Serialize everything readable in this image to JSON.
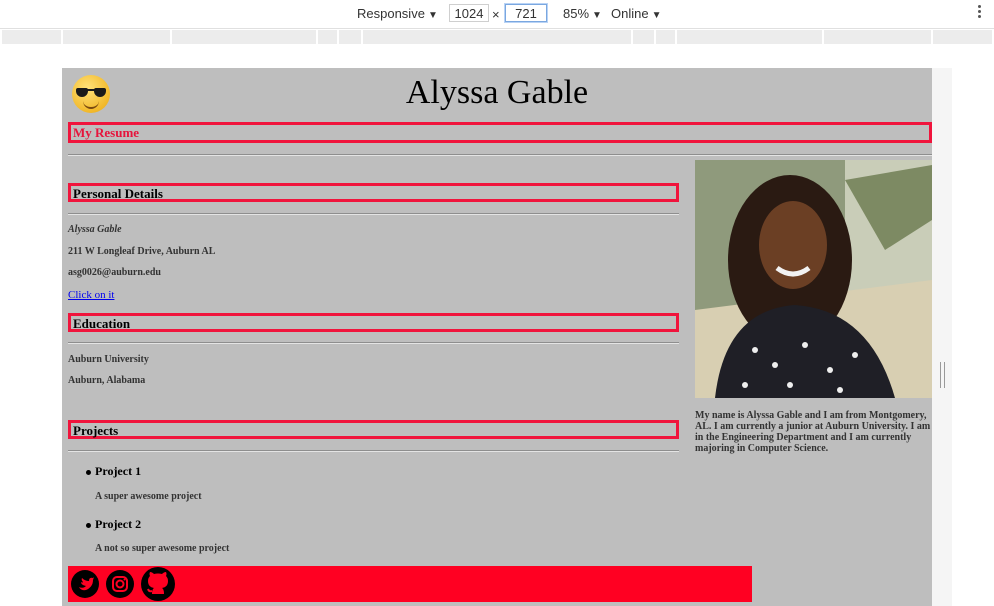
{
  "devtools": {
    "device": "Responsive",
    "width": "1024",
    "height": "721",
    "dimension_separator": "×",
    "zoom": "85%",
    "network": "Online"
  },
  "header": {
    "name": "Alyssa Gable",
    "emoji": "😎",
    "resume_title": "My Resume"
  },
  "personal": {
    "heading": "Personal Details",
    "full_name": "Alyssa Gable",
    "address": "211 W Longleaf Drive, Auburn AL",
    "email": "asg0026@auburn.edu",
    "link_text": "Click on it"
  },
  "education": {
    "heading": "Education",
    "school": "Auburn University",
    "location": "Auburn, Alabama"
  },
  "projects": {
    "heading": "Projects",
    "items": [
      {
        "title": "Project 1",
        "description": "A super awesome project"
      },
      {
        "title": "Project 2",
        "description": "A not so super awesome project"
      }
    ]
  },
  "bio": "My name is Alyssa Gable and I am from Montgomery, AL. I am currently a junior at Auburn University. I am in the Engineering Department and I am currently majoring in Computer Science.",
  "footer": {
    "icons": [
      "twitter-icon",
      "instagram-icon",
      "github-icon"
    ]
  },
  "colors": {
    "accent_red": "#f0143c",
    "footer_red": "#ff0022",
    "page_bg": "#bebebe",
    "link": "#0000ee"
  }
}
